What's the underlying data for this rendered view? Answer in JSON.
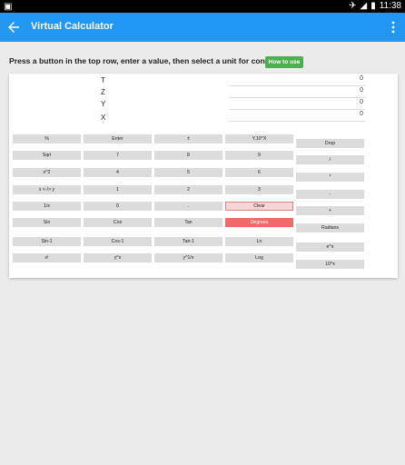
{
  "statusbar": {
    "time": "11:38"
  },
  "appbar": {
    "title": "Virtual Calculator"
  },
  "instructions": "Press a button in the top row, enter a value, then select a unit for conversion.",
  "howto_label": "How to use",
  "stack": [
    {
      "label": "T",
      "value": "0"
    },
    {
      "label": "Z",
      "value": "0"
    },
    {
      "label": "Y",
      "value": "0"
    },
    {
      "label": "X",
      "value": "0"
    }
  ],
  "keys": [
    [
      "%",
      "Enter",
      "±",
      "Y.10^X"
    ],
    [
      "Sqrt",
      "7",
      "8",
      "9"
    ],
    [
      "x^2",
      "4",
      "5",
      "6"
    ],
    [
      "x <-/> y",
      "1",
      "2",
      "3"
    ],
    [
      "1/x",
      "0",
      ".",
      "Clear"
    ],
    [
      "Sin",
      "Cos",
      "Tan",
      "Degrees"
    ],
    [
      "Sin-1",
      "Cos-1",
      "Tan-1",
      "Ln"
    ],
    [
      "x!",
      "y^x",
      "y^1/x",
      "Log"
    ]
  ],
  "side_keys": [
    "Drop",
    "/",
    "*",
    "-",
    "+",
    "Radians",
    "e^x",
    "10^x"
  ]
}
